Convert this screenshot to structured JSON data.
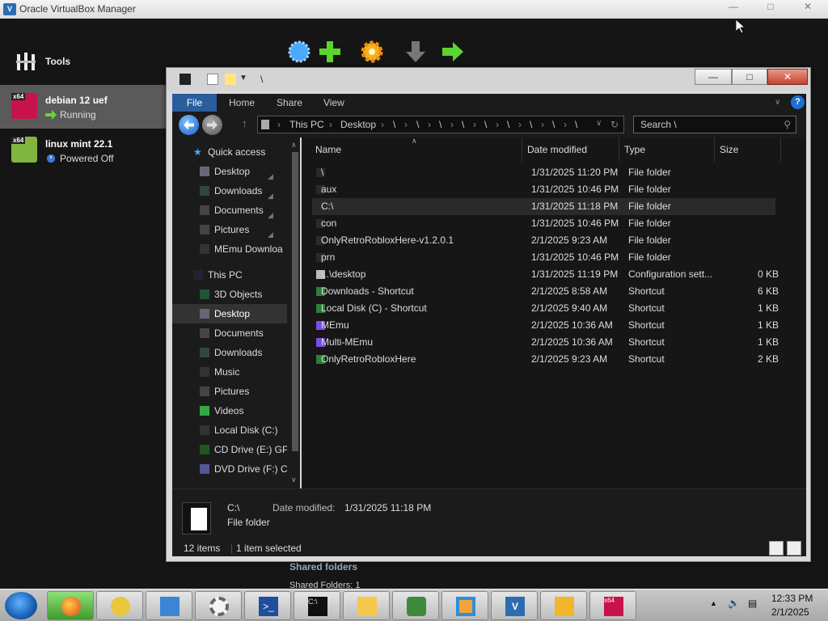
{
  "vbox": {
    "title": "Oracle VirtualBox Manager",
    "tools_label": "Tools",
    "vms": [
      {
        "name": "debian 12 uef",
        "state": "Running",
        "badge": "x64"
      },
      {
        "name": "linux mint 22.1",
        "state": "Powered Off",
        "badge": "x64"
      }
    ],
    "shared_folders": "Shared folders",
    "shared_folders_count": "Shared Folders:  1"
  },
  "explorer": {
    "title_path": "\\",
    "ribbon_tabs": [
      "File",
      "Home",
      "Share",
      "View"
    ],
    "breadcrumb": [
      "This PC",
      "Desktop",
      "\\",
      "\\",
      "\\",
      "\\",
      "\\",
      "\\",
      "\\",
      "\\",
      "\\"
    ],
    "search_placeholder": "Search \\",
    "nav": [
      {
        "label": "Quick access",
        "icon": "star-icon"
      },
      {
        "label": "Desktop",
        "icon": "desktop-folder-icon",
        "pinned": true
      },
      {
        "label": "Downloads",
        "icon": "downloads-folder-icon",
        "pinned": true
      },
      {
        "label": "Documents",
        "icon": "documents-folder-icon",
        "pinned": true
      },
      {
        "label": "Pictures",
        "icon": "pictures-folder-icon",
        "pinned": true
      },
      {
        "label": "MEmu Downloa",
        "icon": "folder-icon"
      },
      {
        "label": "This PC",
        "icon": "computer-icon"
      },
      {
        "label": "3D Objects",
        "icon": "3d-objects-icon"
      },
      {
        "label": "Desktop",
        "icon": "desktop-folder-icon"
      },
      {
        "label": "Documents",
        "icon": "documents-folder-icon"
      },
      {
        "label": "Downloads",
        "icon": "downloads-folder-icon"
      },
      {
        "label": "Music",
        "icon": "music-folder-icon"
      },
      {
        "label": "Pictures",
        "icon": "pictures-folder-icon"
      },
      {
        "label": "Videos",
        "icon": "videos-folder-icon"
      },
      {
        "label": "Local Disk (C:)",
        "icon": "drive-icon"
      },
      {
        "label": "CD Drive (E:) GPa",
        "icon": "cd-drive-icon"
      },
      {
        "label": "DVD Drive (F:) Ci",
        "icon": "dvd-drive-icon"
      }
    ],
    "columns": [
      "Name",
      "Date modified",
      "Type",
      "Size"
    ],
    "files": [
      {
        "name": "\\",
        "date": "1/31/2025 11:20 PM",
        "type": "File folder",
        "size": ""
      },
      {
        "name": "aux",
        "date": "1/31/2025 10:46 PM",
        "type": "File folder",
        "size": ""
      },
      {
        "name": "C:\\",
        "date": "1/31/2025 11:18 PM",
        "type": "File folder",
        "size": ""
      },
      {
        "name": "con",
        "date": "1/31/2025 10:46 PM",
        "type": "File folder",
        "size": ""
      },
      {
        "name": "OnlyRetroRobloxHere-v1.2.0.1",
        "date": "2/1/2025 9:23 AM",
        "type": "File folder",
        "size": ""
      },
      {
        "name": "prn",
        "date": "1/31/2025 10:46 PM",
        "type": "File folder",
        "size": ""
      },
      {
        "name": "\\..\\desktop",
        "date": "1/31/2025 11:19 PM",
        "type": "Configuration sett...",
        "size": "0 KB"
      },
      {
        "name": "Downloads - Shortcut",
        "date": "2/1/2025 8:58 AM",
        "type": "Shortcut",
        "size": "6 KB"
      },
      {
        "name": "Local Disk (C) - Shortcut",
        "date": "2/1/2025 9:40 AM",
        "type": "Shortcut",
        "size": "1 KB"
      },
      {
        "name": "MEmu",
        "date": "2/1/2025 10:36 AM",
        "type": "Shortcut",
        "size": "1 KB"
      },
      {
        "name": "Multi-MEmu",
        "date": "2/1/2025 10:36 AM",
        "type": "Shortcut",
        "size": "1 KB"
      },
      {
        "name": "OnlyRetroRobloxHere",
        "date": "2/1/2025 9:23 AM",
        "type": "Shortcut",
        "size": "2 KB"
      }
    ],
    "details": {
      "name": "C:\\",
      "kind": "File folder",
      "date_label": "Date modified:",
      "date": "1/31/2025 11:18 PM"
    },
    "status": {
      "items": "12 items",
      "selected": "1 item selected"
    }
  },
  "taskbar": {
    "time": "12:33 PM",
    "date": "2/1/2025"
  }
}
